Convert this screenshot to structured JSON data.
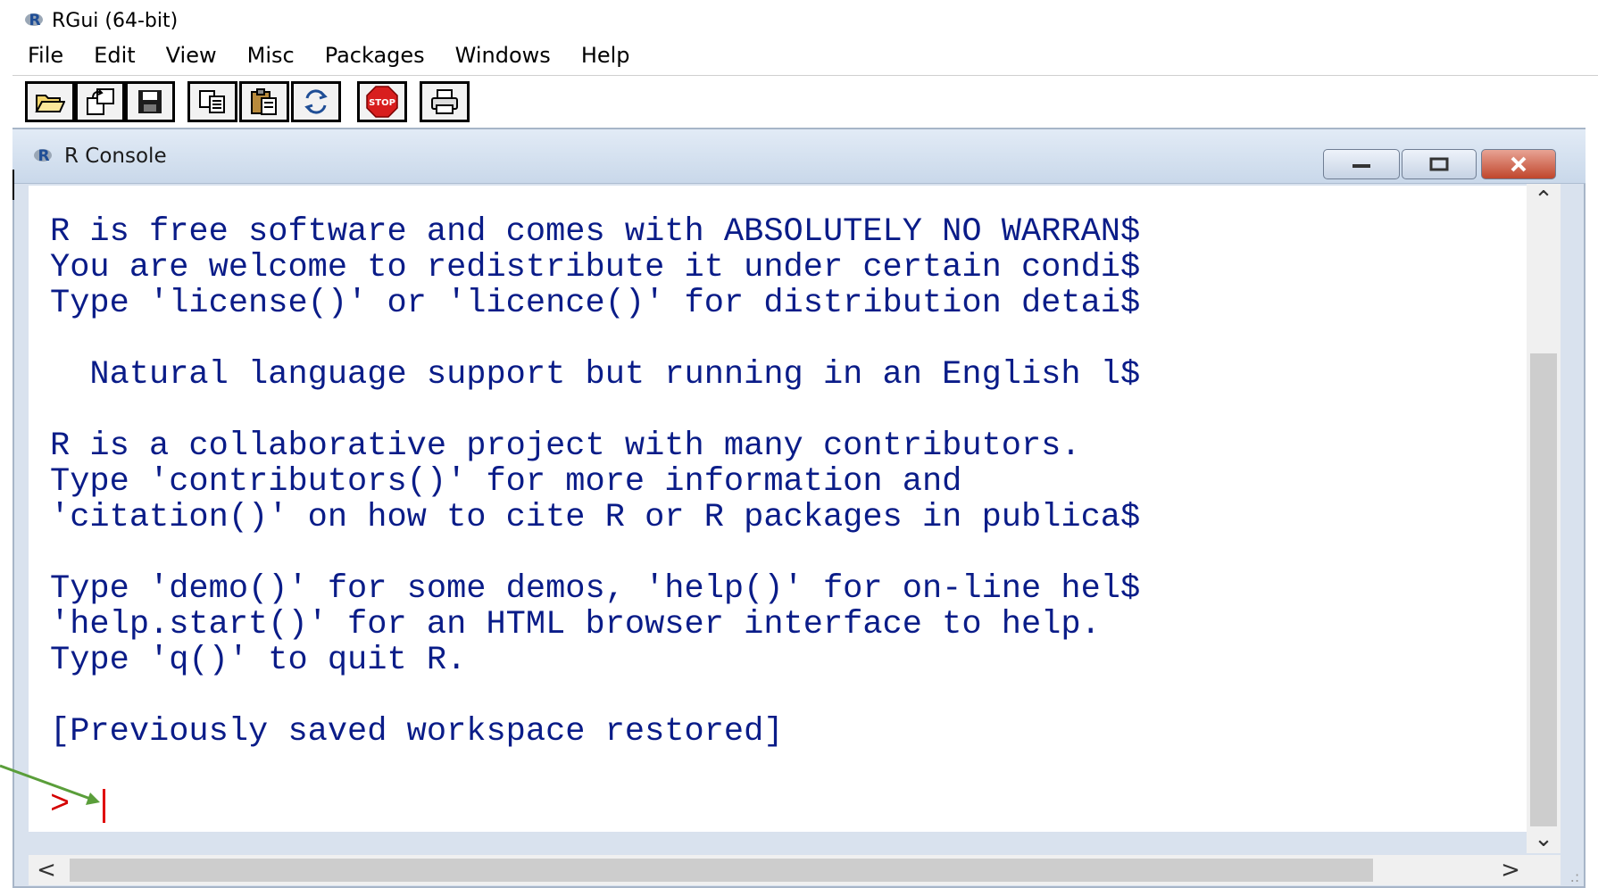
{
  "window": {
    "title": "RGui (64-bit)"
  },
  "menu": [
    {
      "label": "File"
    },
    {
      "label": "Edit"
    },
    {
      "label": "View"
    },
    {
      "label": "Misc"
    },
    {
      "label": "Packages"
    },
    {
      "label": "Windows"
    },
    {
      "label": "Help"
    }
  ],
  "toolbar": {
    "buttons": [
      {
        "icon": "open-folder-icon"
      },
      {
        "icon": "load-workspace-icon"
      },
      {
        "icon": "save-icon"
      },
      {
        "icon": "copy-icon"
      },
      {
        "icon": "paste-icon"
      },
      {
        "icon": "copy-paste-icon"
      },
      {
        "icon": "stop-icon",
        "label": "STOP"
      },
      {
        "icon": "print-icon"
      }
    ]
  },
  "console": {
    "title": "R Console",
    "text": "R is free software and comes with ABSOLUTELY NO WARRAN$\nYou are welcome to redistribute it under certain condi$\nType 'license()' or 'licence()' for distribution detai$\n\n  Natural language support but running in an English l$\n\nR is a collaborative project with many contributors.\nType 'contributors()' for more information and\n'citation()' on how to cite R or R packages in publica$\n\nType 'demo()' for some demos, 'help()' for on-line hel$\n'help.start()' for an HTML browser interface to help.\nType 'q()' to quit R.\n\n[Previously saved workspace restored]",
    "prompt": ">"
  },
  "colors": {
    "console_text": "#0a1c88",
    "prompt": "#d40000",
    "annotation_arrow": "#5a9e3a"
  }
}
